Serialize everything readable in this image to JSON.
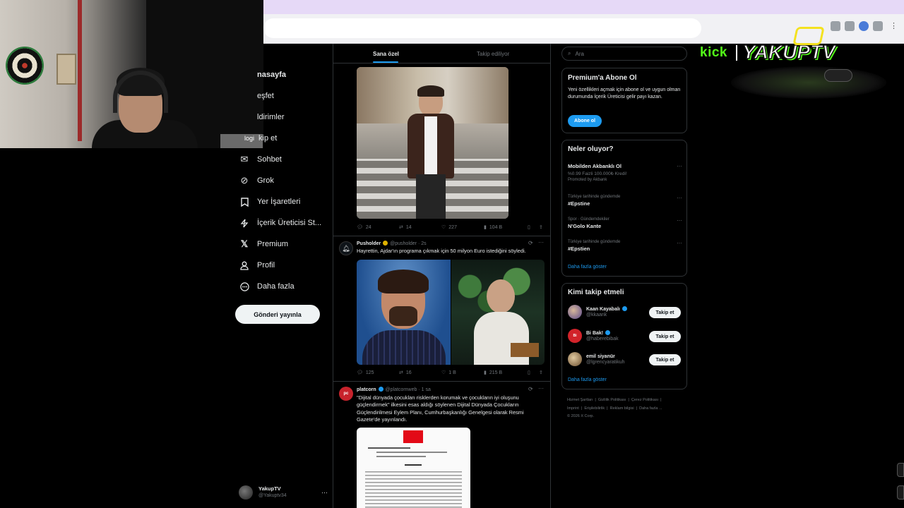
{
  "nav": {
    "items": [
      {
        "label": "nasayfa",
        "icon": "home-icon"
      },
      {
        "label": "eşfet",
        "icon": "explore-icon"
      },
      {
        "label": "ldirimler",
        "icon": "notifications-icon"
      },
      {
        "label": "kip et",
        "icon": "follow-icon"
      },
      {
        "label": "Sohbet",
        "icon": "chat-icon"
      },
      {
        "label": "Grok",
        "icon": "grok-icon"
      },
      {
        "label": "Yer İşaretleri",
        "icon": "bookmark-icon"
      },
      {
        "label": "İçerik Üreticisi St...",
        "icon": "creator-studio-icon"
      },
      {
        "label": "Premium",
        "icon": "x-logo-icon"
      },
      {
        "label": "Profil",
        "icon": "profile-icon"
      },
      {
        "label": "Daha fazla",
        "icon": "more-circle-icon"
      }
    ],
    "post_button": "Gönderi yayınla",
    "webcam_overlay_text": "logi",
    "account": {
      "name": "YakupTV",
      "handle": "@Yakuptv34"
    }
  },
  "feed": {
    "tabs": [
      "Sana özel",
      "Takip ediliyor"
    ],
    "active_tab": 0,
    "tweets": [
      {
        "stats": {
          "replies": "24",
          "reposts": "14",
          "likes": "227",
          "views": "104 B"
        }
      },
      {
        "name": "Pusholder",
        "handle": "@pusholder",
        "time": "· 2s",
        "text": "Hayrettin, Ajdar'ın programa çıkmak için 50 milyon Euro istediğini söyledi.",
        "stats": {
          "replies": "125",
          "reposts": "16",
          "likes": "1 B",
          "views": "215 B"
        }
      },
      {
        "name": "platcorn",
        "handle": "@platcornweb",
        "time": "· 1 sa",
        "text": "\"Dijital dünyada çocukları risklerden korumak ve çocukların iyi oluşunu güçlendirmek\" ilkesini esas aldığı söylenen Dijital Dünyada Çocukların Güçlendirilmesi Eylem Planı, Cumhurbaşkanlığı Genelgesi olarak Resmi Gazete'de yayınlandı."
      }
    ]
  },
  "search": {
    "placeholder": "Ara"
  },
  "premium_card": {
    "title": "Premium'a Abone Ol",
    "body": "Yeni özellikleri açmak için abone ol ve uygun olman durumunda İçerik Üreticisi gelir payı kazan.",
    "button": "Abone ol"
  },
  "trends": {
    "title": "Neler oluyor?",
    "items": [
      {
        "meta": "",
        "topic": "Mobilden Akbanklı Ol",
        "sub": "%0.99 Faizli 100.000₺ Kredi!",
        "promo": "Promoted by Akbank"
      },
      {
        "meta": "Türkiye tarihinde gündemde",
        "topic": "#Epstine"
      },
      {
        "meta": "Spor · Gündemdekiler",
        "topic": "N'Golo Kante"
      },
      {
        "meta": "Türkiye tarihinde gündemde",
        "topic": "#Epstien"
      }
    ],
    "more": "Daha fazla göster"
  },
  "who_to_follow": {
    "title": "Kimi takip etmeli",
    "users": [
      {
        "name": "Kaan Kayabalı",
        "handle": "@kkaank",
        "button": "Takip et"
      },
      {
        "name": "Bi Bak!",
        "handle": "@haberebibak",
        "button": "Takip et"
      },
      {
        "name": "emil siyanür",
        "handle": "@lgrencyaratikuh",
        "button": "Takip et"
      }
    ],
    "more": "Daha fazla göster"
  },
  "footer": {
    "line1": [
      "Hizmet Şartları",
      "Gizlilik Politikası",
      "Çerez Politikası"
    ],
    "line2": [
      "Imprint",
      "Erişilebilirlik",
      "Reklam bilgisi",
      "Daha fazla ..."
    ],
    "copyright": "© 2026 X Corp."
  },
  "overlay": {
    "kick": "kick",
    "brand": "YAKUPTV"
  },
  "colors": {
    "accent": "#1d9bf0",
    "background": "#000000",
    "kick_green": "#53fc18"
  }
}
